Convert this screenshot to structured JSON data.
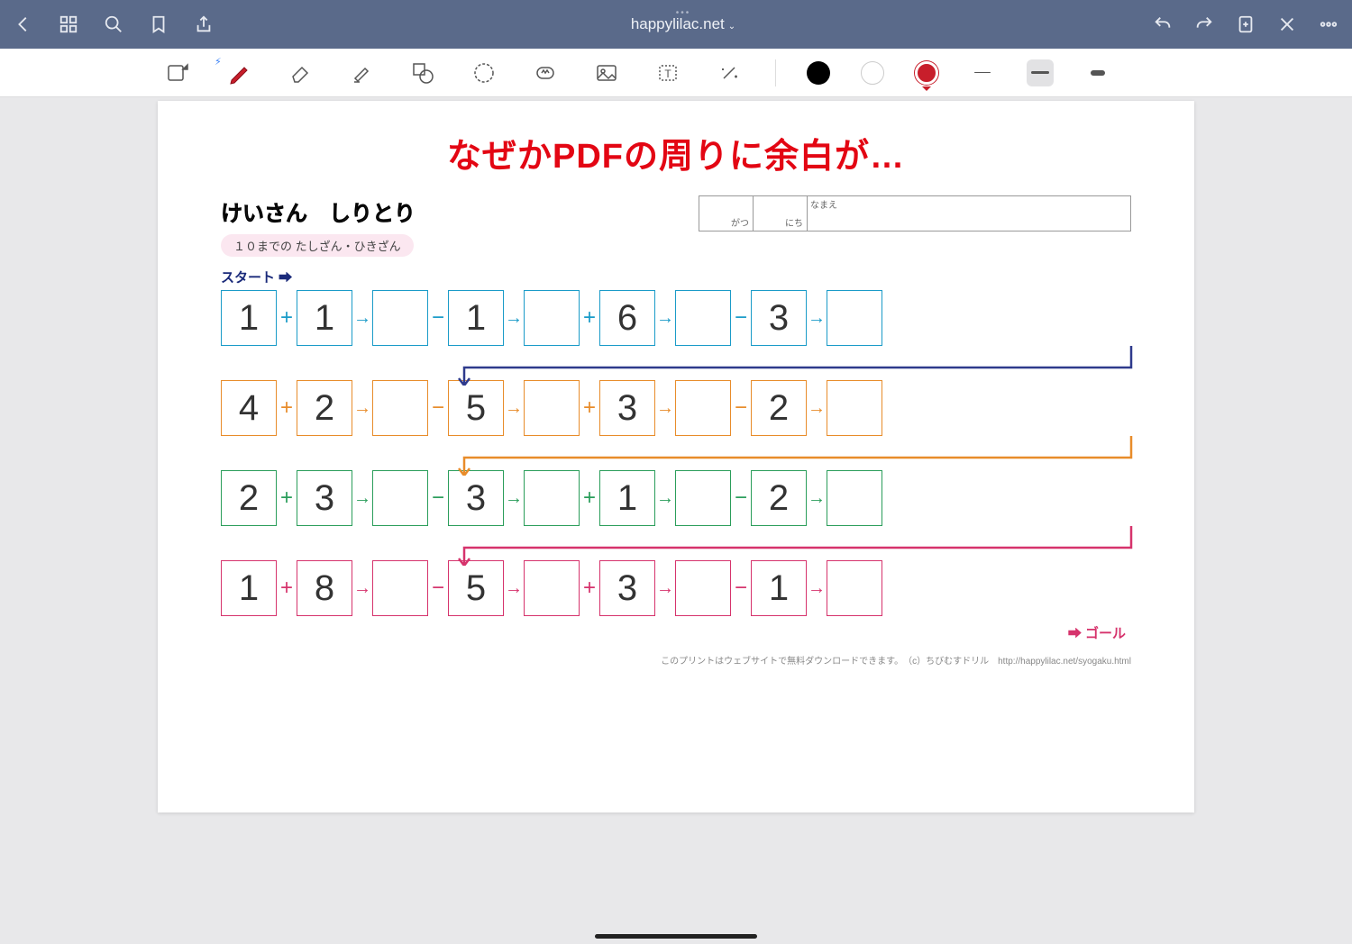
{
  "titlebar": {
    "domain": "happylilac.net"
  },
  "annotation": "なぜかPDFの周りに余白が…",
  "worksheet": {
    "title": "けいさん　しりとり",
    "subtitle": "１０までの たしざん・ひきざん",
    "month_label": "がつ",
    "day_label": "にち",
    "name_label": "なまえ",
    "start_label": "スタート ➡",
    "goal_label": "➡ ゴール",
    "footer": "このプリントはウェブサイトで無料ダウンロードできます。　（c）ちびむすドリル　http://happylilac.net/syogaku.html",
    "rows": [
      {
        "cells": [
          "1",
          "+",
          "1",
          "→",
          "",
          "−",
          "1",
          "→",
          "",
          "+",
          "6",
          "→",
          "",
          "−",
          "3",
          "→",
          ""
        ]
      },
      {
        "cells": [
          "4",
          "+",
          "2",
          "→",
          "",
          "−",
          "5",
          "→",
          "",
          "+",
          "3",
          "→",
          "",
          "−",
          "2",
          "→",
          ""
        ]
      },
      {
        "cells": [
          "2",
          "+",
          "3",
          "→",
          "",
          "−",
          "3",
          "→",
          "",
          "+",
          "1",
          "→",
          "",
          "−",
          "2",
          "→",
          ""
        ]
      },
      {
        "cells": [
          "1",
          "+",
          "8",
          "→",
          "",
          "−",
          "5",
          "→",
          "",
          "+",
          "3",
          "→",
          "",
          "−",
          "1",
          "→",
          ""
        ]
      }
    ]
  },
  "connector_colors": [
    "#2e3a8c",
    "#e88c2a",
    "#d6336c"
  ]
}
